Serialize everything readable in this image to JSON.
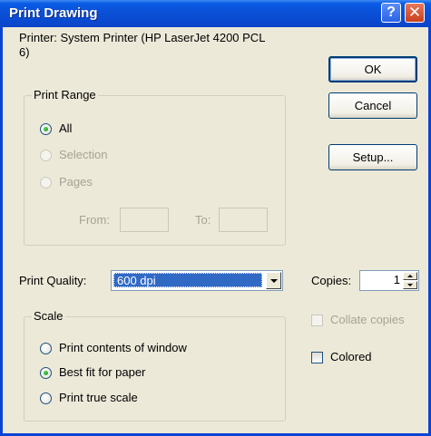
{
  "window": {
    "title": "Print Drawing",
    "help_glyph": "?",
    "close_glyph": "✕"
  },
  "printer": {
    "text_line1": "Printer:  System Printer (HP LaserJet 4200 PCL",
    "text_line2": "6)"
  },
  "buttons": {
    "ok": "OK",
    "cancel": "Cancel",
    "setup": "Setup..."
  },
  "print_range": {
    "title": "Print Range",
    "options": [
      {
        "label": "All",
        "selected": true,
        "enabled": true
      },
      {
        "label": "Selection",
        "selected": false,
        "enabled": false
      },
      {
        "label": "Pages",
        "selected": false,
        "enabled": false
      }
    ],
    "from_label": "From:",
    "from_value": "",
    "to_label": "To:",
    "to_value": ""
  },
  "print_quality": {
    "label": "Print Quality:",
    "selected": "600 dpi"
  },
  "copies": {
    "label": "Copies:",
    "value": "1"
  },
  "scale": {
    "title": "Scale",
    "options": [
      {
        "label": "Print contents of window",
        "selected": false
      },
      {
        "label": "Best fit for paper",
        "selected": true
      },
      {
        "label": "Print true scale",
        "selected": false
      }
    ]
  },
  "checkboxes": {
    "collate": {
      "label": "Collate copies",
      "checked": false,
      "enabled": false
    },
    "colored": {
      "label": "Colored",
      "checked": false,
      "enabled": true
    }
  }
}
